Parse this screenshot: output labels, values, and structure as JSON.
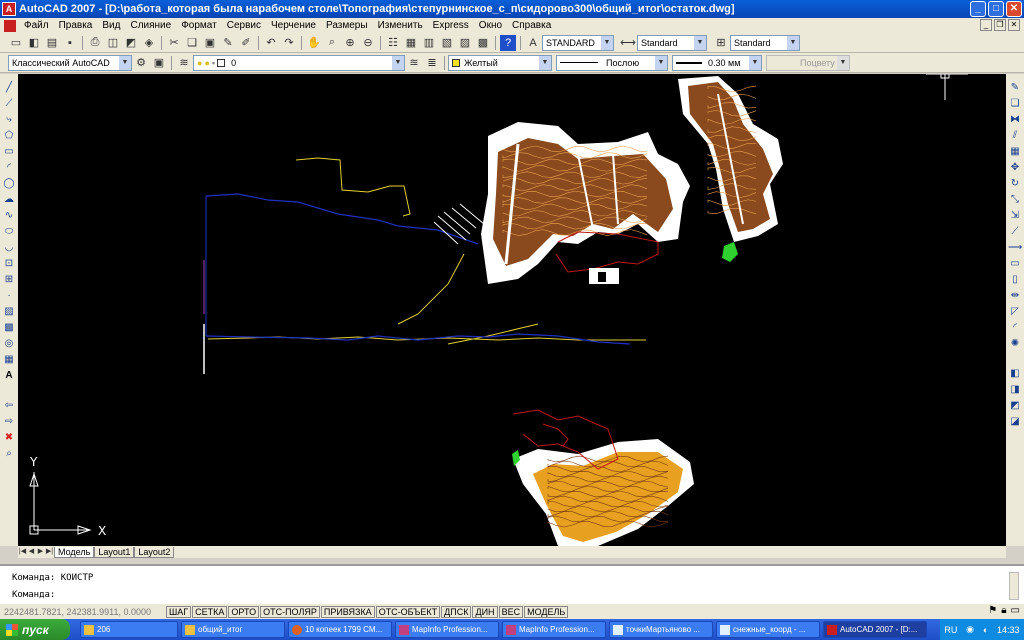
{
  "window": {
    "title": "AutoCAD 2007 - [D:\\работа_которая была нарабочем столе\\Топография\\степурнинское_с_п\\сидорово300\\общий_итог\\остаток.dwg]",
    "min_label": "_",
    "max_label": "□",
    "close_label": "✕"
  },
  "menu": [
    "Файл",
    "Правка",
    "Вид",
    "Слияние",
    "Формат",
    "Сервис",
    "Черчение",
    "Размеры",
    "Изменить",
    "Express",
    "Окно",
    "Справка"
  ],
  "toolbar1": {
    "text_style": "STANDARD",
    "dim_style": "Standard",
    "table_style": "Standard"
  },
  "toolbar2": {
    "workspace": "Классический AutoCAD",
    "layer": "0",
    "color": "Желтый",
    "linetype": "Послою",
    "lineweight": "0.30 мм",
    "plotstyle": "Поцвету"
  },
  "ucs": {
    "x_label": "X",
    "y_label": "Y"
  },
  "layout_tabs": [
    "Модель",
    "Layout1",
    "Layout2"
  ],
  "command": {
    "line1": "Команда: КОИСТР",
    "line2": "Команда:"
  },
  "status": {
    "coords": "2242481.7821, 242381.9911, 0.0000",
    "buttons": [
      "ШАГ",
      "СЕТКА",
      "ОРТО",
      "ОТС-ПОЛЯР",
      "ПРИВЯЗКА",
      "ОТС-ОБЪЕКТ",
      "ДПСК",
      "ДИН",
      "ВЕС",
      "МОДЕЛЬ"
    ]
  },
  "taskbar": {
    "start": "пуск",
    "tasks": [
      "206",
      "общий_итог",
      "10 копеек 1799 CM...",
      "MapInfo Profession...",
      "MapInfo Profession...",
      "точкиМартьяново ...",
      "снежные_коорд - ...",
      "AutoCAD 2007 - [D:..."
    ],
    "lang": "RU",
    "clock": "14:33"
  },
  "colors": {
    "titlebar": "#0a5fd8",
    "canvas_bg": "#000000",
    "contour_brown": "#8a4a1e",
    "contour_orange": "#e8a020",
    "line_yellow": "#e0d030",
    "line_blue": "#2030c0",
    "line_red": "#c01818",
    "accent_green": "#30d030"
  }
}
